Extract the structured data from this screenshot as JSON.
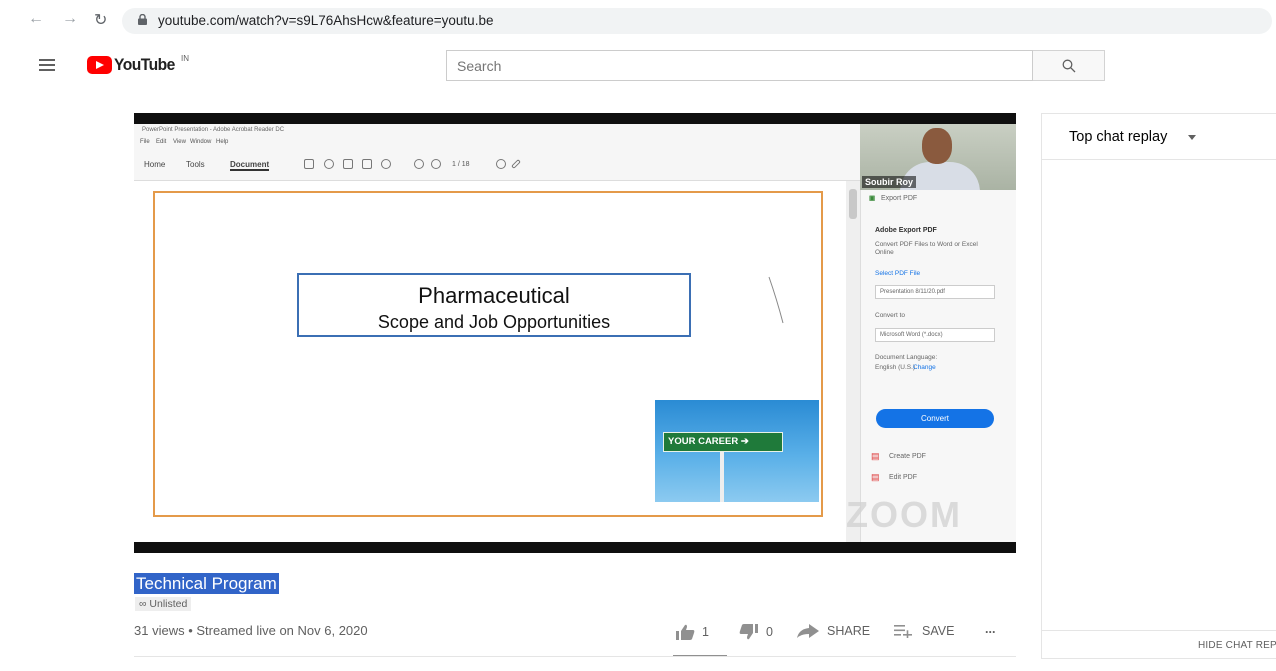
{
  "browser": {
    "url": "youtube.com/watch?v=s9L76AhsHcw&feature=youtu.be"
  },
  "header": {
    "logo_text": "YouTube",
    "country_code": "IN",
    "search_placeholder": "Search"
  },
  "video": {
    "acrobat": {
      "window_title": "PowerPoint Presentation - Adobe Acrobat Reader DC",
      "menu": [
        "File",
        "Edit",
        "View",
        "Window",
        "Help"
      ],
      "tabs": [
        "Home",
        "Tools",
        "Document"
      ],
      "page_indicator": "1 / 18"
    },
    "slide": {
      "title": "Pharmaceutical",
      "subtitle": "Scope and Job Opportunities",
      "sign_text": "YOUR CAREER"
    },
    "webcam_name": "Soubir Roy",
    "side_panel": {
      "export_pdf": "Export PDF",
      "heading": "Adobe Export PDF",
      "desc": "Convert PDF Files to Word or Excel Online",
      "select_file_label": "Select PDF File",
      "file_value": "Presentation 8/11/20.pdf",
      "convert_to_label": "Convert to",
      "convert_to_value": "Microsoft Word (*.docx)",
      "doc_lang_label": "Document Language:",
      "doc_lang_value": "English (U.S.)",
      "change_link": "Change",
      "convert_button": "Convert",
      "create_pdf": "Create PDF",
      "edit_pdf": "Edit PDF"
    },
    "watermark": "ZOOM"
  },
  "chat": {
    "header_label": "Top chat replay",
    "hide_label": "HIDE CHAT REPLAY"
  },
  "info": {
    "title": "Technical Program",
    "privacy": "Unlisted",
    "meta": "31 views • Streamed live on Nov 6, 2020",
    "likes": "1",
    "dislikes": "0",
    "share_label": "SHARE",
    "save_label": "SAVE",
    "more_label": "..."
  },
  "colors": {
    "youtube_red": "#ff0000",
    "title_highlight": "#3164c8",
    "acrobat_blue": "#1473e6",
    "slide_border": "#e49a4a"
  }
}
